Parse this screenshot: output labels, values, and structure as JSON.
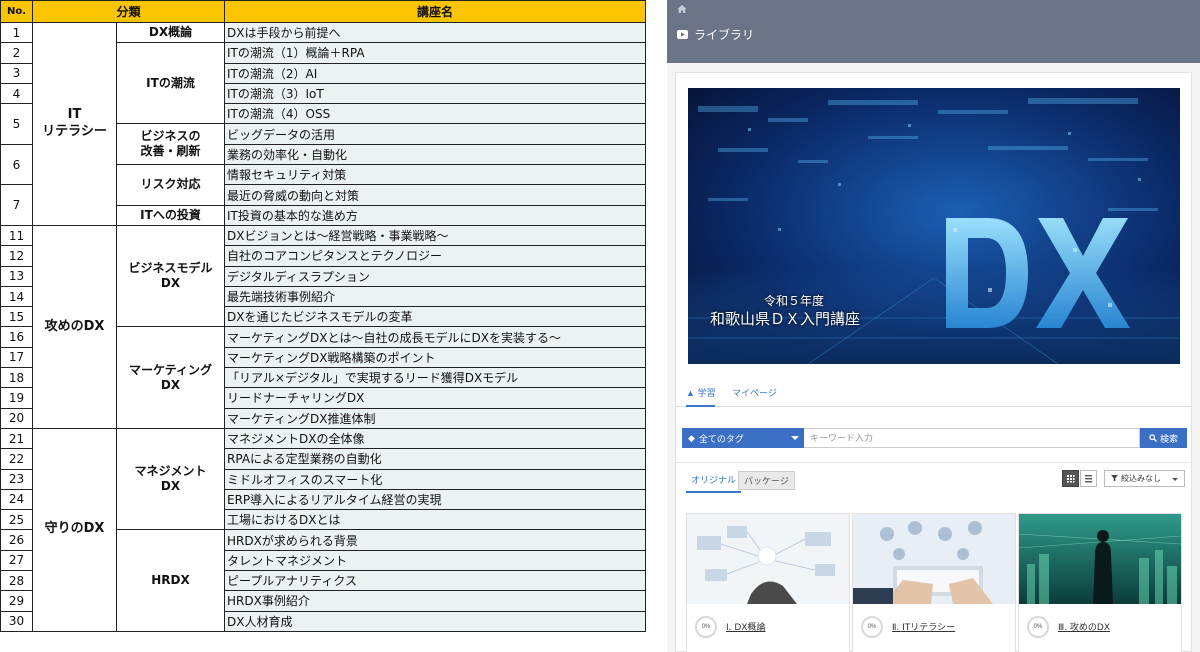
{
  "table": {
    "headers": {
      "no": "No.",
      "category": "分類",
      "course": "講座名"
    },
    "groups": [
      {
        "label": "IT\nリテラシー",
        "subgroups": [
          {
            "label": "DX概論",
            "courses": [
              "DXは手段から前提へ"
            ]
          },
          {
            "label": "ITの潮流",
            "courses": [
              "ITの潮流（1）概論＋RPA",
              "ITの潮流（2）AI",
              "ITの潮流（3）IoT",
              "ITの潮流（4）OSS"
            ]
          },
          {
            "label": "ビジネスの\n改善・刷新",
            "courses": [
              "ビッグデータの活用",
              "業務の効率化・自動化"
            ]
          },
          {
            "label": "リスク対応",
            "courses": [
              "情報セキュリティ対策",
              "最近の脅威の動向と対策"
            ]
          },
          {
            "label": "ITへの投資",
            "courses": [
              "IT投資の基本的な進め方"
            ]
          }
        ]
      },
      {
        "label": "攻めのDX",
        "subgroups": [
          {
            "label": "ビジネスモデル\nDX",
            "courses": [
              "DXビジョンとは～経営戦略・事業戦略～",
              "自社のコアコンピタンスとテクノロジー",
              "デジタルディスラプション",
              "最先端技術事例紹介",
              "DXを通じたビジネスモデルの変革"
            ]
          },
          {
            "label": "マーケティング\nDX",
            "courses": [
              "マーケティングDXとは～自社の成長モデルにDXを実装する～",
              "マーケティングDX戦略構築のポイント",
              "「リアル×デジタル」で実現するリード獲得DXモデル",
              "リードナーチャリングDX",
              "マーケティングDX推進体制"
            ]
          }
        ]
      },
      {
        "label": "守りのDX",
        "subgroups": [
          {
            "label": "マネジメント\nDX",
            "courses": [
              "マネジメントDXの全体像",
              "RPAによる定型業務の自動化",
              "ミドルオフィスのスマート化",
              "ERP導入によるリアルタイム経営の実現",
              "工場におけるDXとは"
            ]
          },
          {
            "label": "HRDX",
            "courses": [
              "HRDXが求められる背景",
              "タレントマネジメント",
              "ピープルアナリティクス",
              "HRDX事例紹介",
              "DX人材育成"
            ]
          }
        ]
      }
    ],
    "numbers_it": [
      "1",
      "2",
      "3",
      "4",
      "5",
      "6",
      "7"
    ],
    "numbers_rest": [
      "11",
      "12",
      "13",
      "14",
      "15",
      "16",
      "17",
      "18",
      "19",
      "20",
      "21",
      "22",
      "23",
      "24",
      "25",
      "26",
      "27",
      "28",
      "29",
      "30"
    ]
  },
  "library": {
    "title": "ライブラリ",
    "banner": {
      "sub": "令和５年度",
      "main": "和歌山県ＤＸ入門講座"
    },
    "tabs": [
      {
        "label": "学習",
        "active": true
      },
      {
        "label": "マイページ",
        "active": false
      }
    ],
    "search": {
      "tag_label": "全てのタグ",
      "placeholder": "キーワード入力",
      "button": "検索"
    },
    "subtabs": [
      {
        "label": "オリジナル",
        "active": true
      },
      {
        "label": "パッケージ",
        "active": false
      }
    ],
    "filter_label": "絞込みなし",
    "cards": [
      {
        "progress": "0%",
        "title": "Ⅰ. DX概論"
      },
      {
        "progress": "0%",
        "title": "Ⅱ. ITリテラシー"
      },
      {
        "progress": "0%",
        "title": "Ⅲ. 攻めのDX"
      }
    ],
    "colors": {
      "topbar": "#6a7486",
      "accent": "#3b6fc4",
      "header_yellow": "#f9c400",
      "course_bg": "#eaf2f2"
    }
  }
}
